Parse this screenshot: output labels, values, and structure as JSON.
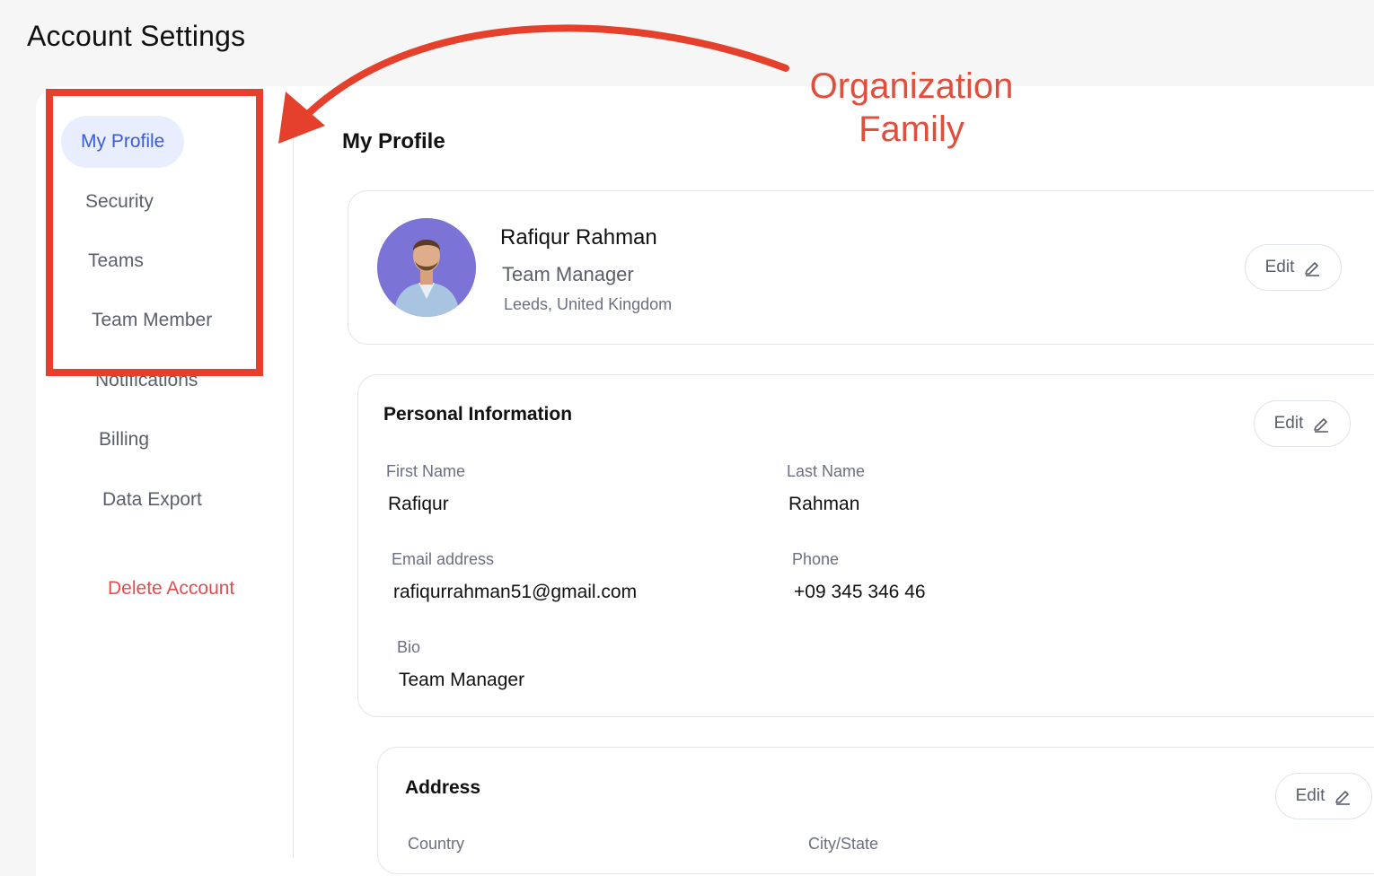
{
  "page": {
    "title": "Account Settings"
  },
  "sidebar": {
    "items": [
      {
        "label": "My Profile"
      },
      {
        "label": "Security"
      },
      {
        "label": "Teams"
      },
      {
        "label": "Team Member"
      },
      {
        "label": "Notifications"
      },
      {
        "label": "Billing"
      },
      {
        "label": "Data Export"
      }
    ],
    "delete_label": "Delete Account"
  },
  "annotation": {
    "line1": "Organization",
    "line2": "Family",
    "color": "#e4402c"
  },
  "main": {
    "title": "My Profile",
    "profile": {
      "name": "Rafiqur Rahman",
      "role": "Team Manager",
      "location": "Leeds, United Kingdom",
      "edit_label": "Edit",
      "avatar_icon": "person-photo"
    },
    "personal": {
      "title": "Personal Information",
      "edit_label": "Edit",
      "first_name_label": "First Name",
      "first_name": "Rafiqur",
      "last_name_label": "Last Name",
      "last_name": "Rahman",
      "email_label": "Email address",
      "email": "rafiqurrahman51@gmail.com",
      "phone_label": "Phone",
      "phone": "+09 345 346 46",
      "bio_label": "Bio",
      "bio": "Team Manager"
    },
    "address": {
      "title": "Address",
      "edit_label": "Edit",
      "country_label": "Country",
      "city_label": "City/State"
    }
  },
  "colors": {
    "accent": "#3b5bdb",
    "danger": "#e24d4d",
    "avatar_bg": "#7b74d6"
  }
}
